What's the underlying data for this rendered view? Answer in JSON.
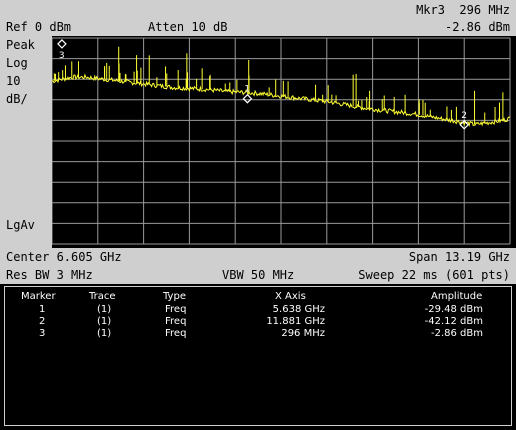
{
  "header": {
    "marker_readout": "Mkr3  296 MHz",
    "ref_level": "Ref 0 dBm",
    "attenuation": "Atten 10 dB",
    "marker_amplitude": "-2.86 dBm"
  },
  "left_panel": {
    "detector": "Peak",
    "scale_type": "Log",
    "scale_value": "10",
    "scale_unit": "dB/",
    "averaging": "LgAv"
  },
  "footer": {
    "center": "Center 6.605 GHz",
    "span": "Span 13.19 GHz",
    "rbw": "Res BW 3 MHz",
    "vbw": "VBW 50 MHz",
    "sweep": "Sweep 22 ms (601 pts)"
  },
  "marker_table": {
    "headers": [
      "Marker",
      "Trace",
      "Type",
      "X Axis",
      "Amplitude"
    ],
    "rows": [
      [
        "1",
        "(1)",
        "Freq",
        "5.638 GHz",
        "-29.48 dBm"
      ],
      [
        "2",
        "(1)",
        "Freq",
        "11.881 GHz",
        "-42.12 dBm"
      ],
      [
        "3",
        "(1)",
        "Freq",
        "296 MHz",
        "-2.86 dBm"
      ]
    ]
  },
  "colors": {
    "trace": "#ffff33",
    "grid": "#9a9a9a",
    "panel": "#cfcfcf",
    "screen": "#000000"
  },
  "chart_data": {
    "type": "line",
    "x_unit": "GHz",
    "y_unit": "dBm",
    "xlim": [
      0.01,
      13.2
    ],
    "ylim": [
      -100,
      0
    ],
    "grid": true,
    "markers": [
      {
        "label": "1",
        "x": 5.638,
        "y": -29.48
      },
      {
        "label": "2",
        "x": 11.881,
        "y": -42.12
      },
      {
        "label": "3",
        "x": 0.296,
        "y": -2.86
      }
    ],
    "series": [
      {
        "x": [
          0.01,
          0.3,
          0.6,
          1.0,
          1.5,
          2.0,
          2.5,
          3.0,
          3.5,
          4.0,
          4.5,
          5.0,
          5.638,
          6.0,
          6.5,
          7.0,
          7.5,
          8.0,
          8.5,
          9.0,
          9.5,
          10.0,
          10.5,
          11.0,
          11.5,
          11.881,
          12.2,
          12.6,
          13.0,
          13.2
        ],
        "y": [
          -21,
          -20,
          -19,
          -19,
          -20,
          -21,
          -22,
          -23,
          -24,
          -24.5,
          -25,
          -26,
          -26.5,
          -27,
          -28,
          -29,
          -30,
          -31,
          -32.5,
          -34,
          -35,
          -36,
          -37,
          -38.5,
          -40,
          -41,
          -42,
          -41,
          -40,
          -39
        ]
      }
    ]
  }
}
